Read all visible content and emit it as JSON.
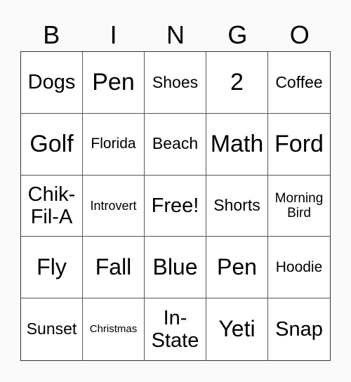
{
  "header": {
    "letters": [
      "B",
      "I",
      "N",
      "G",
      "O"
    ]
  },
  "board": {
    "rows": [
      [
        "Dogs",
        "Pen",
        "Shoes",
        "2",
        "Coffee"
      ],
      [
        "Golf",
        "Florida",
        "Beach",
        "Math",
        "Ford"
      ],
      [
        "Chik-\nFil-A",
        "Introvert",
        "Free!",
        "Shorts",
        "Morning\nBird"
      ],
      [
        "Fly",
        "Fall",
        "Blue",
        "Pen",
        "Hoodie"
      ],
      [
        "Sunset",
        "Christmas",
        "In-\nState",
        "Yeti",
        "Snap"
      ]
    ],
    "free_space": "Free!"
  }
}
